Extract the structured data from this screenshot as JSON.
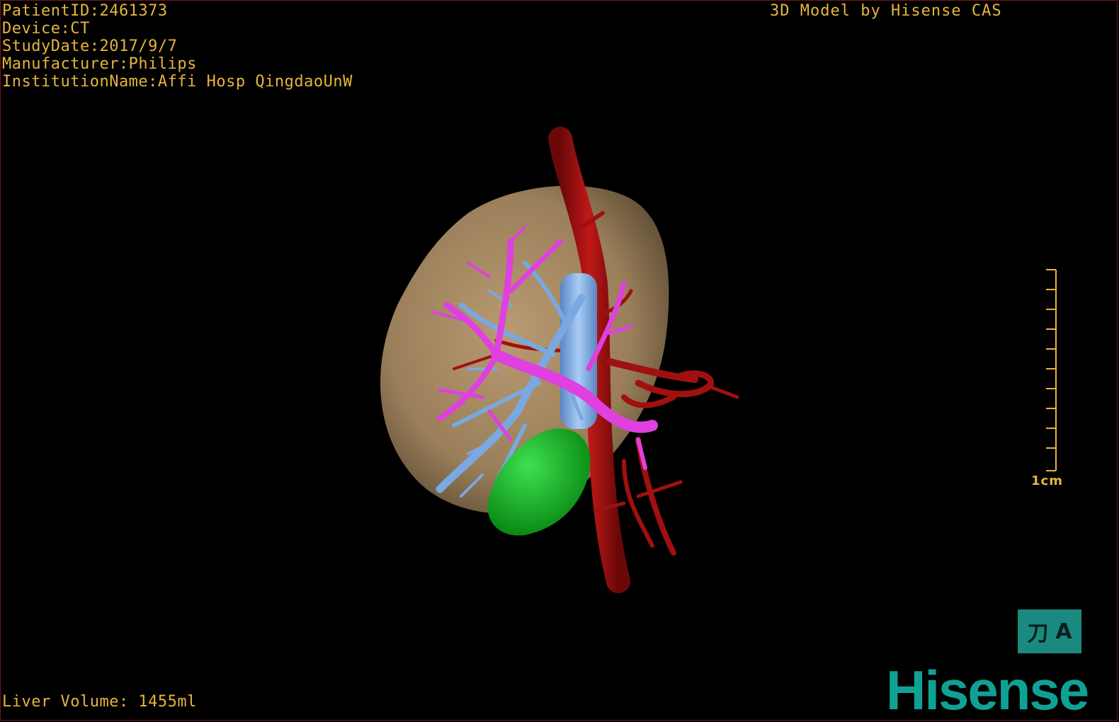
{
  "patient_info": {
    "patient_id": "PatientID:2461373",
    "device": "Device:CT",
    "study_date": "StudyDate:2017/9/7",
    "manufacturer": "Manufacturer:Philips",
    "institution": "InstitutionName:Affi Hosp QingdaoUnW"
  },
  "model_credit": "3D Model by Hisense CAS",
  "scale_bar": {
    "label": "1cm"
  },
  "liver_volume": "Liver Volume: 1455ml",
  "view_toggle": {
    "glyph_left": "刀",
    "glyph_right": "A"
  },
  "brand": "Hisense",
  "colors": {
    "overlay_text": "#e6b43c",
    "liver": "#b89a72",
    "portal_vein": "#e040e0",
    "hepatic_vein": "#7aa8e0",
    "artery": "#a01010",
    "gallbladder": "#10c020",
    "brand": "#0fa294"
  }
}
